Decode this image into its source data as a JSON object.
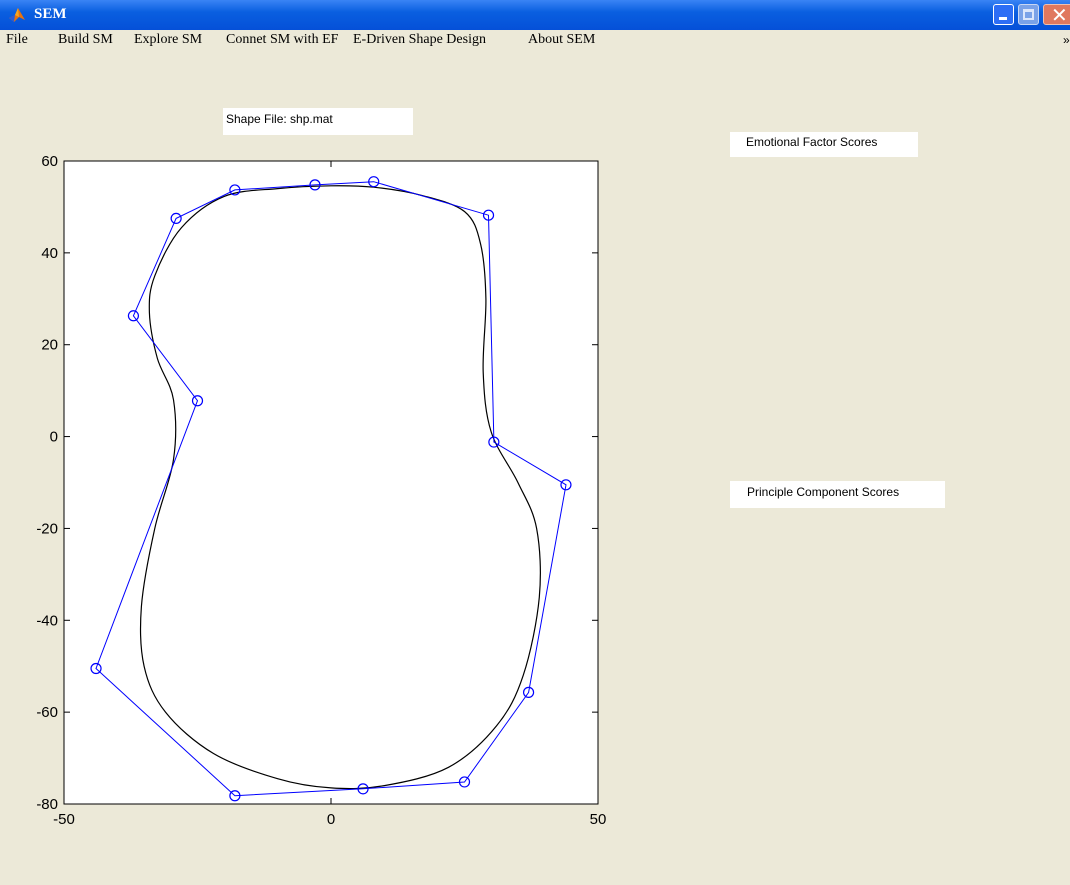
{
  "window": {
    "title": "SEM",
    "icon": "matlab-logo-icon",
    "controls": [
      "minimize-icon",
      "maximize-icon",
      "close-icon"
    ]
  },
  "menu": {
    "items": [
      "File",
      "Build SM",
      "Explore SM",
      "Connet SM with EF",
      "E-Driven Shape Design",
      "About SEM"
    ],
    "overflow_glyph": "»"
  },
  "labels": {
    "shape_file": "Shape File: shp.mat",
    "emotional_factor_scores": "Emotional Factor Scores",
    "principle_component_scores": "Principle Component Scores"
  },
  "chart_data": {
    "type": "line",
    "title": "",
    "xlabel": "",
    "ylabel": "",
    "xlim": [
      -50,
      50
    ],
    "ylim": [
      -80,
      60
    ],
    "x_ticks": [
      -50,
      0,
      50
    ],
    "y_ticks": [
      60,
      40,
      20,
      0,
      -20,
      -40,
      -60,
      -80
    ],
    "grid": false,
    "series": [
      {
        "color": "#0000ff",
        "marker": "circle",
        "closed": true,
        "points": [
          [
            8,
            55.5
          ],
          [
            -3,
            54.8
          ],
          [
            -18,
            53.7
          ],
          [
            -29,
            47.5
          ],
          [
            -37,
            26.3
          ],
          [
            -25,
            7.8
          ],
          [
            -44,
            -50.5
          ],
          [
            -18,
            -78.2
          ],
          [
            6,
            -76.7
          ],
          [
            25,
            -75.2
          ],
          [
            37,
            -55.7
          ],
          [
            44,
            -10.5
          ],
          [
            30.5,
            -1.2
          ],
          [
            29.5,
            48.2
          ]
        ]
      },
      {
        "color": "#000000",
        "marker": "none",
        "closed": true,
        "points": [
          [
            0,
            54.6
          ],
          [
            -10,
            54.0
          ],
          [
            -20,
            52.3
          ],
          [
            -28,
            45.5
          ],
          [
            -33,
            35.0
          ],
          [
            -34,
            27.0
          ],
          [
            -32.5,
            17.0
          ],
          [
            -29.5,
            8.0
          ],
          [
            -29.5,
            -5.0
          ],
          [
            -33,
            -20.0
          ],
          [
            -35.5,
            -37.0
          ],
          [
            -35,
            -50.0
          ],
          [
            -31,
            -60.0
          ],
          [
            -22,
            -69.0
          ],
          [
            -10,
            -74.5
          ],
          [
            0,
            -76.5
          ],
          [
            10,
            -76.0
          ],
          [
            22,
            -72.0
          ],
          [
            31,
            -63.0
          ],
          [
            36,
            -52.0
          ],
          [
            39,
            -35.0
          ],
          [
            38.5,
            -20.0
          ],
          [
            35,
            -10.0
          ],
          [
            30,
            1.0
          ],
          [
            28.5,
            14.0
          ],
          [
            29,
            30.0
          ],
          [
            28,
            42.0
          ],
          [
            25,
            49.0
          ],
          [
            17,
            52.5
          ],
          [
            8,
            54.3
          ]
        ]
      }
    ]
  }
}
